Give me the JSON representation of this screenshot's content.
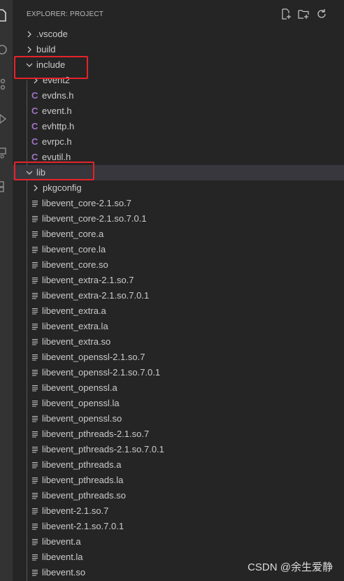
{
  "explorer": {
    "title": "EXPLORER: PROJECT",
    "actions": [
      "new-file-icon",
      "new-folder-icon",
      "refresh-icon"
    ]
  },
  "tree": [
    {
      "label": ".vscode",
      "kind": "folder",
      "expanded": false,
      "depth": 0
    },
    {
      "label": "build",
      "kind": "folder",
      "expanded": false,
      "depth": 0
    },
    {
      "label": "include",
      "kind": "folder",
      "expanded": true,
      "depth": 0
    },
    {
      "label": "event2",
      "kind": "folder",
      "expanded": false,
      "depth": 1
    },
    {
      "label": "evdns.h",
      "kind": "c-header",
      "depth": 1
    },
    {
      "label": "event.h",
      "kind": "c-header",
      "depth": 1
    },
    {
      "label": "evhttp.h",
      "kind": "c-header",
      "depth": 1
    },
    {
      "label": "evrpc.h",
      "kind": "c-header",
      "depth": 1
    },
    {
      "label": "evutil.h",
      "kind": "c-header",
      "depth": 1
    },
    {
      "label": "lib",
      "kind": "folder",
      "expanded": true,
      "depth": 0,
      "hovered": true
    },
    {
      "label": "pkgconfig",
      "kind": "folder",
      "expanded": false,
      "depth": 1
    },
    {
      "label": "libevent_core-2.1.so.7",
      "kind": "file",
      "depth": 1
    },
    {
      "label": "libevent_core-2.1.so.7.0.1",
      "kind": "file",
      "depth": 1
    },
    {
      "label": "libevent_core.a",
      "kind": "file",
      "depth": 1
    },
    {
      "label": "libevent_core.la",
      "kind": "file",
      "depth": 1
    },
    {
      "label": "libevent_core.so",
      "kind": "file",
      "depth": 1
    },
    {
      "label": "libevent_extra-2.1.so.7",
      "kind": "file",
      "depth": 1
    },
    {
      "label": "libevent_extra-2.1.so.7.0.1",
      "kind": "file",
      "depth": 1
    },
    {
      "label": "libevent_extra.a",
      "kind": "file",
      "depth": 1
    },
    {
      "label": "libevent_extra.la",
      "kind": "file",
      "depth": 1
    },
    {
      "label": "libevent_extra.so",
      "kind": "file",
      "depth": 1
    },
    {
      "label": "libevent_openssl-2.1.so.7",
      "kind": "file",
      "depth": 1
    },
    {
      "label": "libevent_openssl-2.1.so.7.0.1",
      "kind": "file",
      "depth": 1
    },
    {
      "label": "libevent_openssl.a",
      "kind": "file",
      "depth": 1
    },
    {
      "label": "libevent_openssl.la",
      "kind": "file",
      "depth": 1
    },
    {
      "label": "libevent_openssl.so",
      "kind": "file",
      "depth": 1
    },
    {
      "label": "libevent_pthreads-2.1.so.7",
      "kind": "file",
      "depth": 1
    },
    {
      "label": "libevent_pthreads-2.1.so.7.0.1",
      "kind": "file",
      "depth": 1
    },
    {
      "label": "libevent_pthreads.a",
      "kind": "file",
      "depth": 1
    },
    {
      "label": "libevent_pthreads.la",
      "kind": "file",
      "depth": 1
    },
    {
      "label": "libevent_pthreads.so",
      "kind": "file",
      "depth": 1
    },
    {
      "label": "libevent-2.1.so.7",
      "kind": "file",
      "depth": 1
    },
    {
      "label": "libevent-2.1.so.7.0.1",
      "kind": "file",
      "depth": 1
    },
    {
      "label": "libevent.a",
      "kind": "file",
      "depth": 1
    },
    {
      "label": "libevent.la",
      "kind": "file",
      "depth": 1
    },
    {
      "label": "libevent.so",
      "kind": "file",
      "depth": 1
    }
  ],
  "icons": {
    "c_header_glyph": "C"
  },
  "colors": {
    "background": "#252526",
    "activity_bar": "#333333",
    "hover_row": "#37373d",
    "c_icon": "#a074c4",
    "annotation": "#e5232a"
  },
  "annotations": [
    "include",
    "lib"
  ],
  "watermark": "CSDN @余生爱静"
}
